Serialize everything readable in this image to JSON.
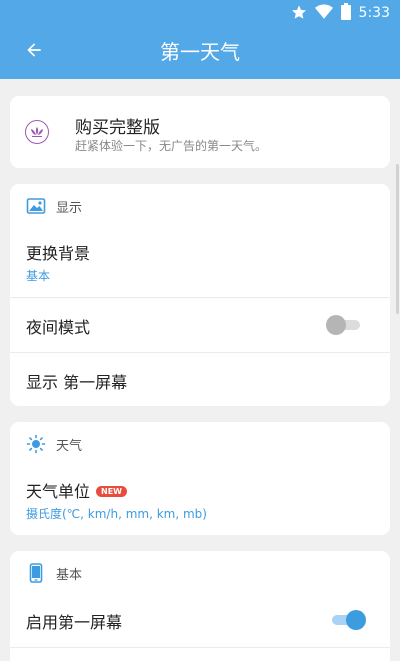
{
  "status_bar": {
    "time": "5:33",
    "icons": [
      "star-icon",
      "wifi-icon",
      "battery-icon"
    ]
  },
  "app_bar": {
    "title": "第一天气",
    "back_icon": "arrow-left-icon"
  },
  "purchase": {
    "title": "购买完整版",
    "subtitle": "赶紧体验一下，无广告的第一天气。",
    "icon": "lotus-icon"
  },
  "display_section": {
    "label": "显示",
    "icon": "wallpaper-icon",
    "items": [
      {
        "title": "更换背景",
        "subtitle": "基本"
      },
      {
        "title": "夜间模式",
        "toggle_on": false
      },
      {
        "title": "显示 第一屏幕"
      }
    ]
  },
  "weather_section": {
    "label": "天气",
    "icon": "sun-icon",
    "items": [
      {
        "title": "天气单位",
        "badge": "NEW",
        "subtitle": "摄氏度(℃, km/h, mm, km, mb)"
      }
    ]
  },
  "basic_section": {
    "label": "基本",
    "icon": "phone-icon",
    "items": [
      {
        "title": "启用第一屏幕",
        "toggle_on": true
      }
    ]
  },
  "colors": {
    "primary": "#53a8e8",
    "accent": "#3d9be0",
    "badge": "#e74c3c",
    "background": "#f0f0f0"
  }
}
